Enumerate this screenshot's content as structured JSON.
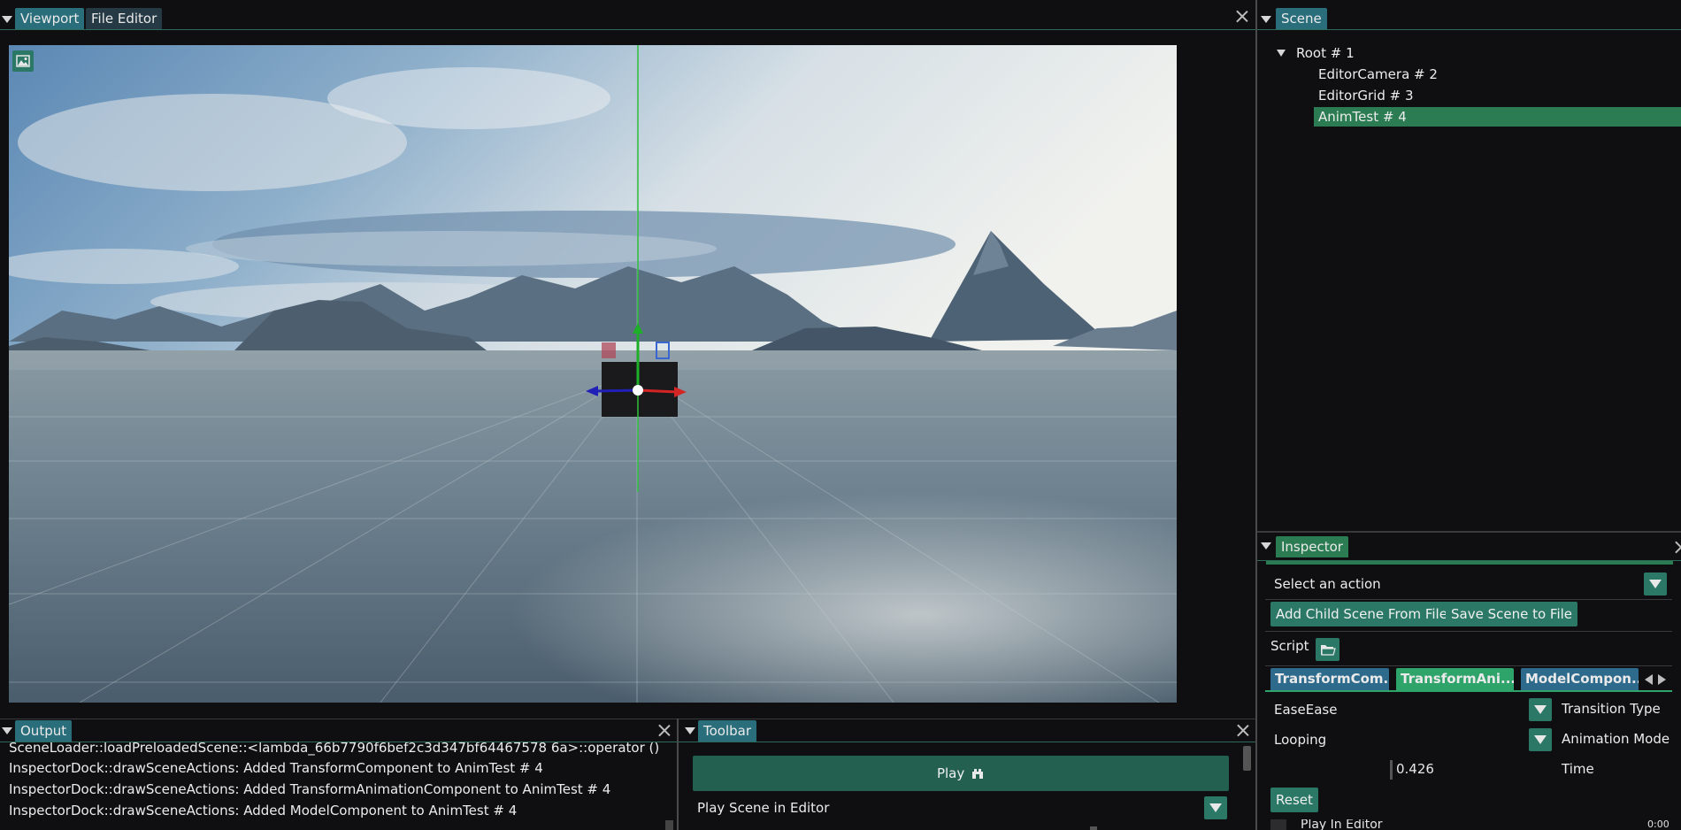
{
  "viewport_panel": {
    "tabs": [
      {
        "label": "Viewport",
        "active": true
      },
      {
        "label": "File Editor",
        "active": false
      }
    ]
  },
  "scene_panel": {
    "tab": "Scene",
    "tree": [
      {
        "label": "Root # 1",
        "expanded": true
      },
      {
        "label": "EditorCamera # 2"
      },
      {
        "label": "EditorGrid # 3"
      },
      {
        "label": "AnimTest # 4",
        "selected": true
      }
    ]
  },
  "inspector_panel": {
    "tab": "Inspector",
    "action_select": "Select an action",
    "add_child_button": "Add Child Scene From File",
    "save_scene_button": "Save Scene to File",
    "script_label": "Script",
    "component_tabs": [
      {
        "label": "TransformCom...",
        "active": false
      },
      {
        "label": "TransformAni...",
        "active": true
      },
      {
        "label": "ModelCompon...",
        "active": false
      }
    ],
    "properties": {
      "transition_value": "EaseEase",
      "transition_label": "Transition Type",
      "animation_mode_value": "Looping",
      "animation_mode_label": "Animation Mode",
      "time_value": "0.426",
      "time_label": "Time"
    },
    "reset_button": "Reset",
    "play_in_editor": "Play In Editor"
  },
  "output_panel": {
    "tab": "Output",
    "lines": [
      "SceneLoader::loadPreloadedScene::<lambda_66b7790f6bef2c3d347bf64467578 6a>::operator (): Loaded scei",
      "InspectorDock::drawSceneActions: Added TransformComponent to AnimTest # 4",
      "InspectorDock::drawSceneActions: Added TransformAnimationComponent to AnimTest # 4",
      "InspectorDock::drawSceneActions: Added ModelComponent to AnimTest # 4"
    ]
  },
  "toolbar_panel": {
    "tab": "Toolbar",
    "play_button": "Play",
    "play_mode_select": "Play Scene in Editor"
  },
  "status": {
    "clock": "0:00"
  },
  "colors": {
    "accent": "#2b7866",
    "tab_active": "#2a6e7c",
    "selected_row": "#2b7c52",
    "component_tab": "#2d6a8c",
    "component_tab_active": "#2ea36a"
  }
}
